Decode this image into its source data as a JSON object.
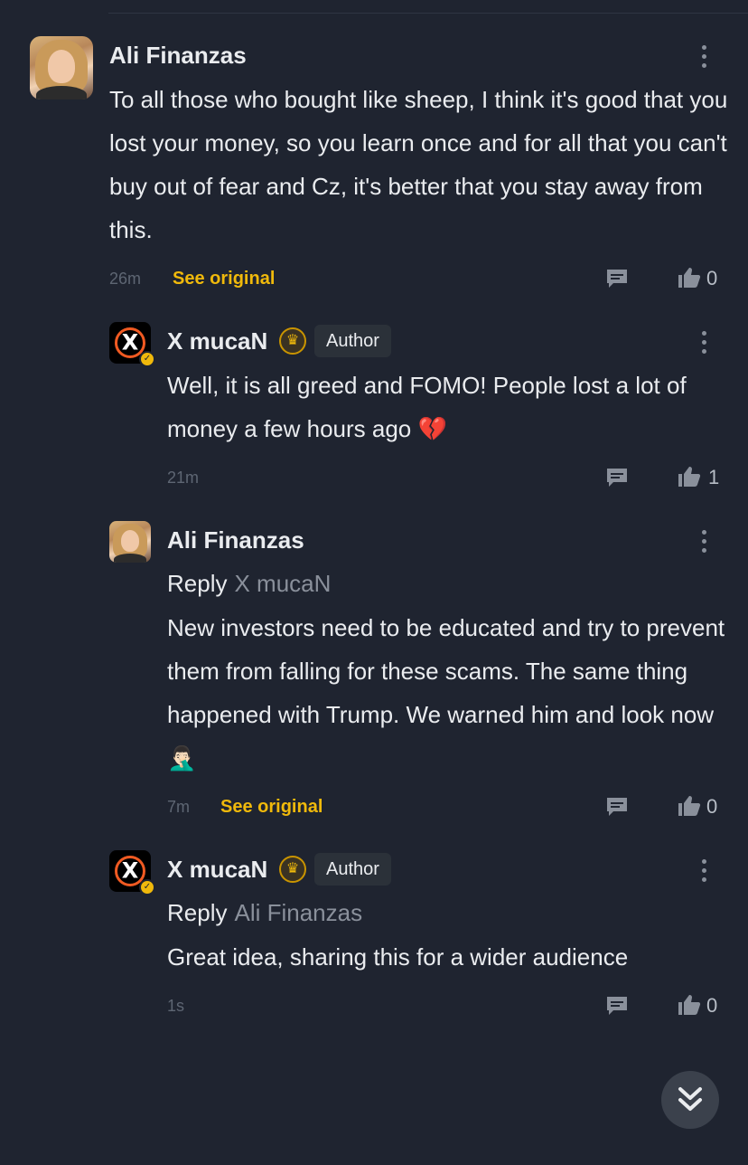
{
  "comments": [
    {
      "author": "Ali Finanzas",
      "text": "To all those who bought like sheep, I think it's good that you lost your money, so you learn once and for all that you can't buy out of fear and Cz, it's better that you stay away from this.",
      "time": "26m",
      "see_original": "See original",
      "likes": "0"
    },
    {
      "author": "X mucaN",
      "author_tag": "Author",
      "text": "Well, it is all greed and FOMO! People lost a lot of money a few hours ago 💔",
      "time": "21m",
      "likes": "1"
    },
    {
      "author": "Ali Finanzas",
      "reply_label": "Reply",
      "reply_to": "X mucaN",
      "text": "New investors need to be educated and try to prevent them from falling for these scams. The same thing happened with Trump. We warned him and look now 🤦🏻‍♂️",
      "time": "7m",
      "see_original": "See original",
      "likes": "0"
    },
    {
      "author": "X mucaN",
      "author_tag": "Author",
      "reply_label": "Reply",
      "reply_to": "Ali Finanzas",
      "text": "Great idea, sharing this for a wider audience",
      "time": "1s",
      "likes": "0"
    }
  ],
  "icons": {
    "menu": "more-vertical-icon",
    "comment": "comment-icon",
    "like": "thumbs-up-icon",
    "scroll": "double-chevron-down-icon",
    "badge": "crown-badge-icon"
  },
  "colors": {
    "background": "#1f2430",
    "accent": "#f0b90b",
    "muted": "#5e6673"
  }
}
